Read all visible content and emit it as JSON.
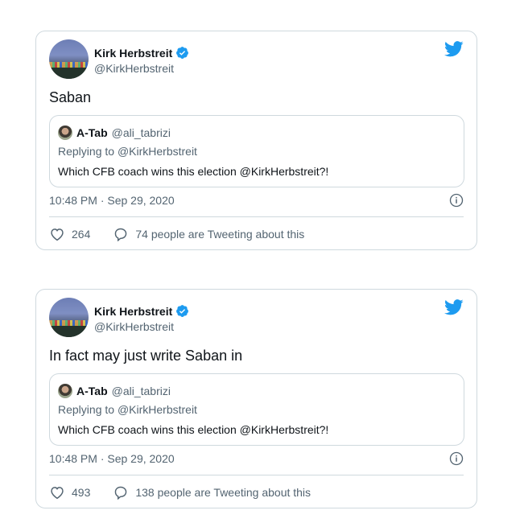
{
  "colors": {
    "twitter_blue": "#1d9bf0",
    "secondary_text": "#536471",
    "border": "#cfd9de"
  },
  "tweets": [
    {
      "author_name": "Kirk Herbstreit",
      "author_handle": "@KirkHerbstreit",
      "verified": true,
      "text": "Saban",
      "quoted": {
        "author_name": "A-Tab",
        "author_handle": "@ali_tabrizi",
        "replying_prefix": "Replying to ",
        "replying_to": "@KirkHerbstreit",
        "text": "Which CFB coach wins this election @KirkHerbstreit?!"
      },
      "timestamp": "10:48 PM · Sep 29, 2020",
      "likes": "264",
      "tweeting_about": "74 people are Tweeting about this"
    },
    {
      "author_name": "Kirk Herbstreit",
      "author_handle": "@KirkHerbstreit",
      "verified": true,
      "text": "In fact may just write Saban in",
      "quoted": {
        "author_name": "A-Tab",
        "author_handle": "@ali_tabrizi",
        "replying_prefix": "Replying to ",
        "replying_to": "@KirkHerbstreit",
        "text": "Which CFB coach wins this election @KirkHerbstreit?!"
      },
      "timestamp": "10:48 PM · Sep 29, 2020",
      "likes": "493",
      "tweeting_about": "138 people are Tweeting about this"
    }
  ],
  "icons": [
    "twitter-bird-icon",
    "verified-badge-icon",
    "info-icon",
    "heart-icon",
    "comment-bubble-icon"
  ]
}
